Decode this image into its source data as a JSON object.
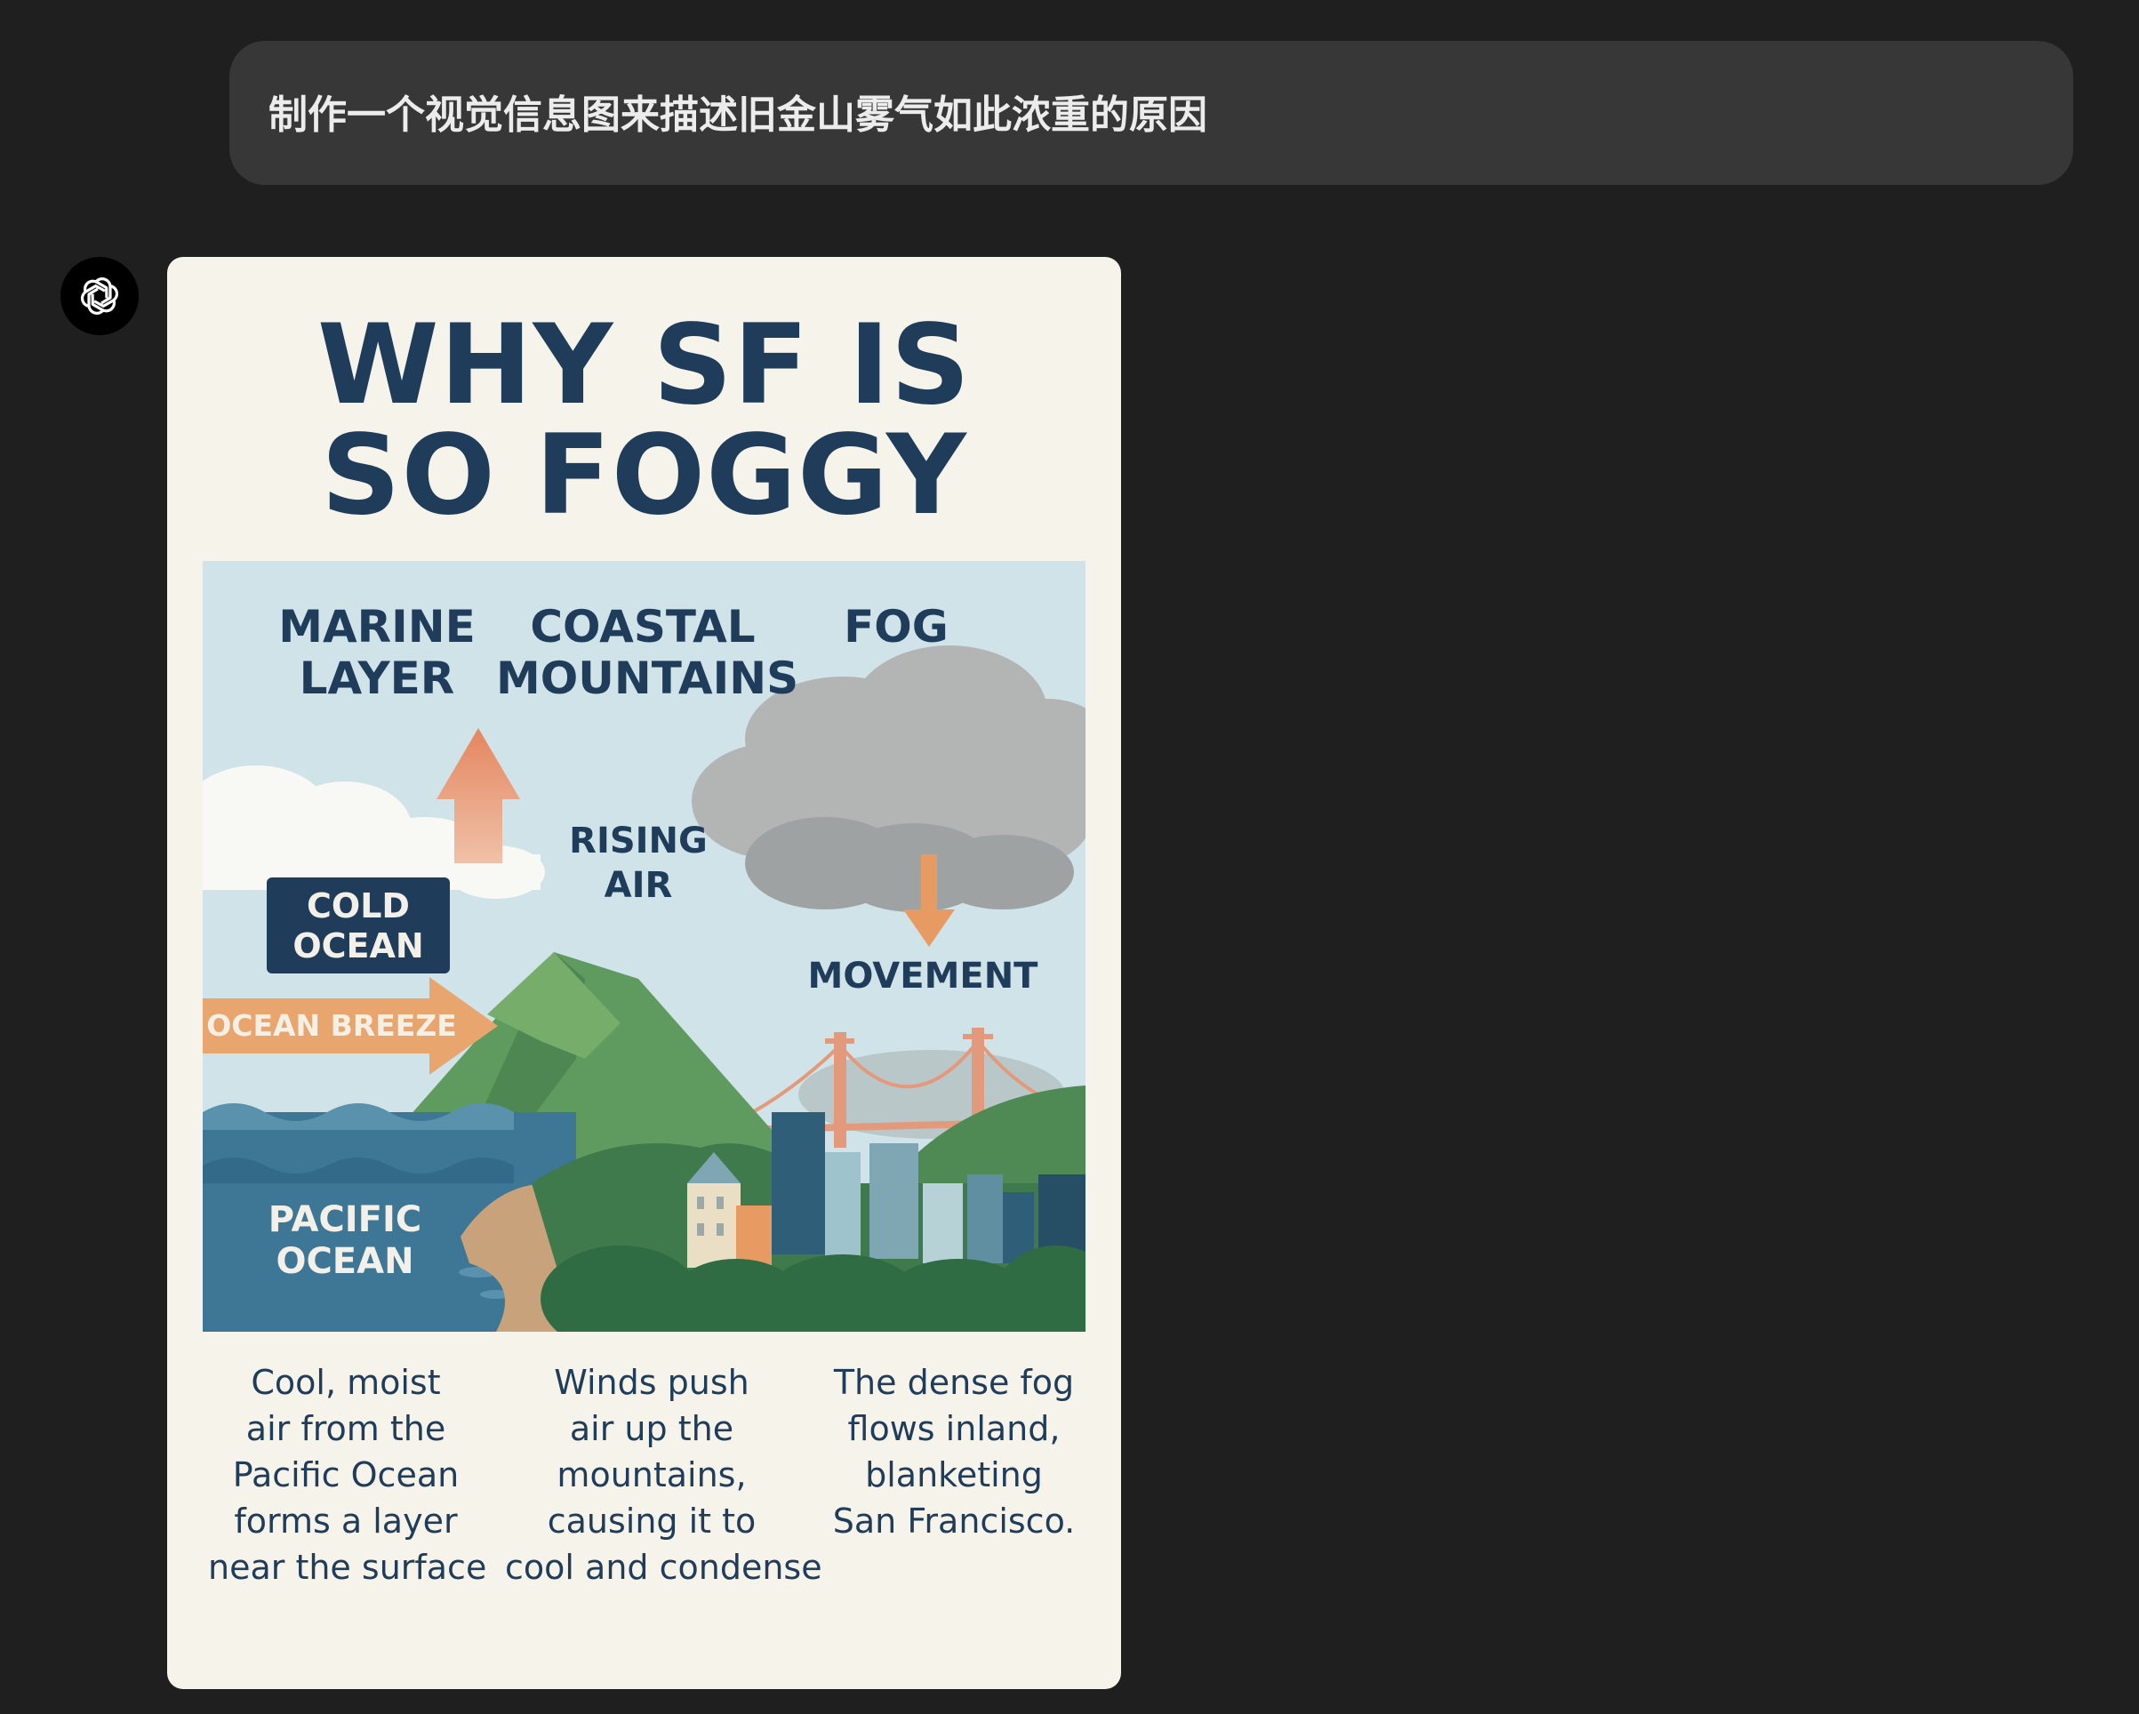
{
  "conversation": {
    "user_prompt": "制作一个视觉信息图来描述旧金山雾气如此浓重的原因",
    "assistant_avatar_icon": "openai-logo-icon"
  },
  "infographic": {
    "title_lines": [
      "WHY SF IS",
      "SO FOGGY"
    ],
    "headings": {
      "marine_layer": [
        "MARINE",
        "LAYER"
      ],
      "coastal_mountains": [
        "COASTAL",
        "MOUNTAINS"
      ],
      "fog": "FOG"
    },
    "labels": {
      "cold_ocean": [
        "COLD",
        "OCEAN"
      ],
      "ocean_breeze": "OCEAN BREEZE",
      "rising_air": [
        "RISING",
        "AIR"
      ],
      "movement": "MOVEMENT",
      "pacific_ocean": [
        "PACIFIC",
        "OCEAN"
      ]
    },
    "descriptions": [
      [
        "Cool, moist",
        "air from the",
        "Pacific Ocean",
        "forms a layer",
        "near the surface"
      ],
      [
        "Winds push",
        "air up the",
        "mountains,",
        "causing it to",
        "cool and condense"
      ],
      [
        "The dense fog",
        "flows inland,",
        "blanketing",
        "San Francisco."
      ]
    ],
    "colors": {
      "navy": "#1f3d5a",
      "sky": "#cfe3e8",
      "orange": "#e89a63",
      "rising_arrow": "#e4865f",
      "ocean": "#3e7696",
      "mountain": "#5f9a5e",
      "bridge": "#e39a7c",
      "fog": "#b3b5b4",
      "paper": "#f6f3ea"
    }
  }
}
